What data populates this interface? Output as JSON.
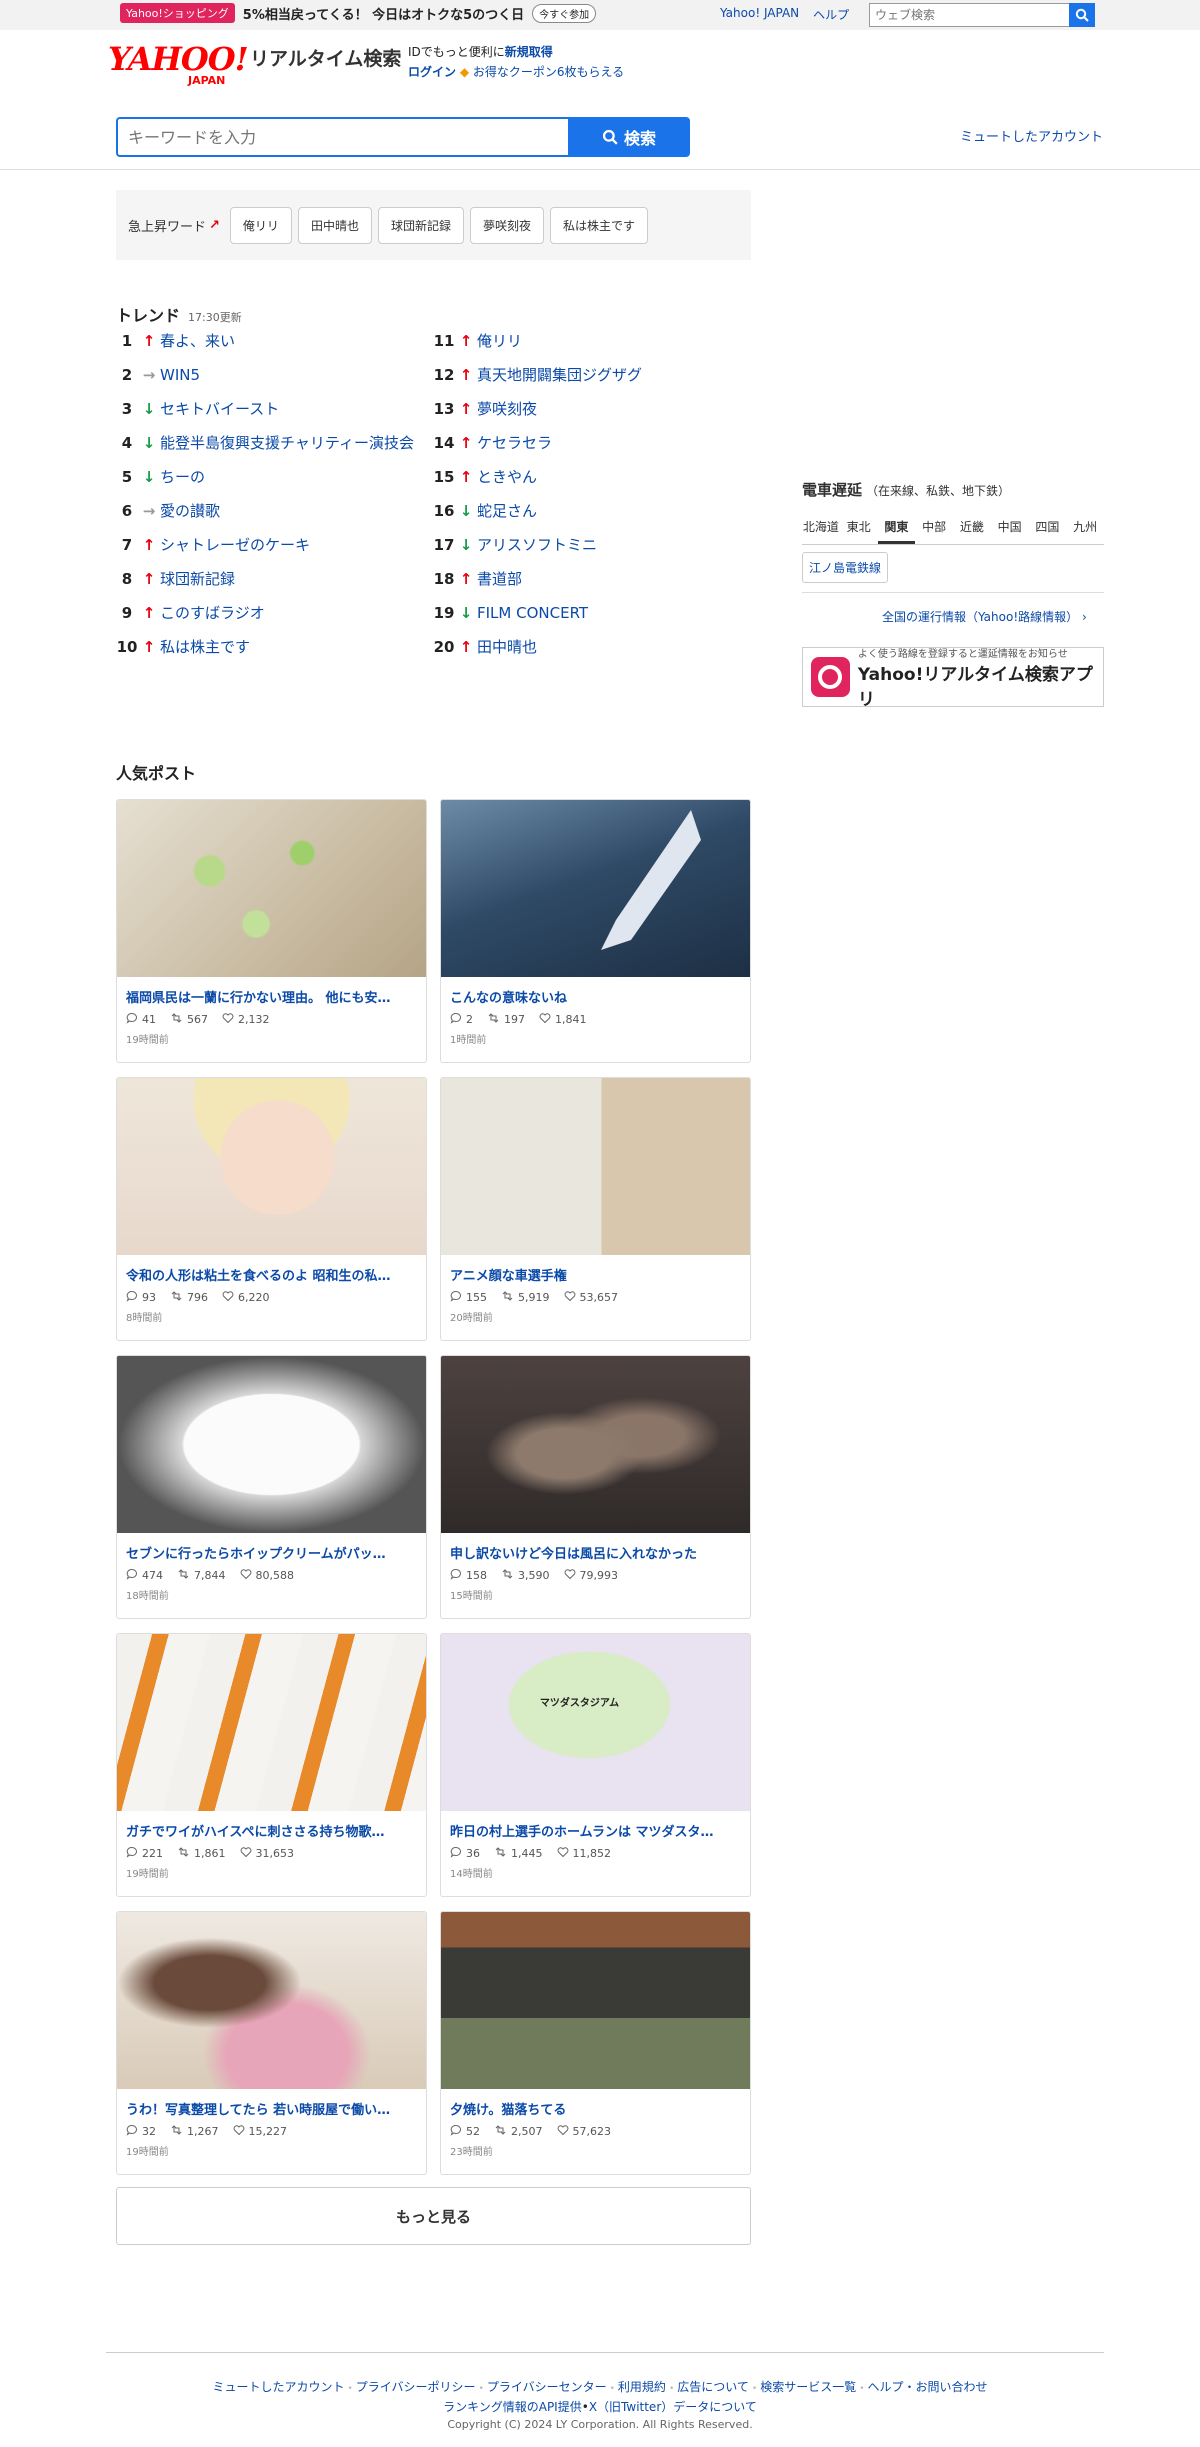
{
  "topbar": {
    "promo_tag": "Yahoo!ショッピング",
    "promo_text": "5%相当戻ってくる！ 今日はオトクな5のつく日",
    "promo_button": "今すぐ参加",
    "links": [
      "Yahoo! JAPAN",
      "ヘルプ"
    ],
    "web_search_placeholder": "ウェブ検索"
  },
  "header": {
    "logo": "YAHOO!",
    "logo_sub": "JAPAN",
    "service_name": "リアルタイム検索",
    "login_line1_prefix": "IDでもっと便利に",
    "login_line1_link": "新規取得",
    "login_link": "ログイン",
    "coupon": "お得なクーポン6枚もらえる",
    "search_placeholder": "キーワードを入力",
    "search_button": "検索",
    "muted_accounts": "ミュートしたアカウント"
  },
  "rising": {
    "label": "急上昇ワード",
    "words": [
      "俺リリ",
      "田中晴也",
      "球団新記録",
      "夢咲刻夜",
      "私は株主です"
    ]
  },
  "trend": {
    "title": "トレンド",
    "updated": "17:30更新",
    "items": [
      {
        "rank": "1",
        "dir": "up",
        "word": "春よ、来い"
      },
      {
        "rank": "2",
        "dir": "flat",
        "word": "WIN5"
      },
      {
        "rank": "3",
        "dir": "down",
        "word": "セキトバイースト"
      },
      {
        "rank": "4",
        "dir": "down",
        "word": "能登半島復興支援チャリティー演技会"
      },
      {
        "rank": "5",
        "dir": "down",
        "word": "ちーの"
      },
      {
        "rank": "6",
        "dir": "flat",
        "word": "愛の讃歌"
      },
      {
        "rank": "7",
        "dir": "up",
        "word": "シャトレーゼのケーキ"
      },
      {
        "rank": "8",
        "dir": "up",
        "word": "球団新記録"
      },
      {
        "rank": "9",
        "dir": "up",
        "word": "このすばラジオ"
      },
      {
        "rank": "10",
        "dir": "up",
        "word": "私は株主です"
      },
      {
        "rank": "11",
        "dir": "up",
        "word": "俺リリ"
      },
      {
        "rank": "12",
        "dir": "up",
        "word": "真天地開闢集団ジグザグ"
      },
      {
        "rank": "13",
        "dir": "up",
        "word": "夢咲刻夜"
      },
      {
        "rank": "14",
        "dir": "up",
        "word": "ケセラセラ"
      },
      {
        "rank": "15",
        "dir": "up",
        "word": "ときやん"
      },
      {
        "rank": "16",
        "dir": "down",
        "word": "蛇足さん"
      },
      {
        "rank": "17",
        "dir": "down",
        "word": "アリスソフトミニ"
      },
      {
        "rank": "18",
        "dir": "up",
        "word": "書道部"
      },
      {
        "rank": "19",
        "dir": "down",
        "word": "FILM CONCERT"
      },
      {
        "rank": "20",
        "dir": "up",
        "word": "田中晴也"
      }
    ]
  },
  "sidebar": {
    "train_title": "電車遅延",
    "train_sub": "（在来線、私鉄、地下鉄）",
    "regions": [
      "北海道",
      "東北",
      "関東",
      "中部",
      "近畿",
      "中国",
      "四国",
      "九州"
    ],
    "active_region": "関東",
    "delayed_line": "江ノ島電鉄線",
    "ops_link": "全国の運行情報（Yahoo!路線情報）",
    "app_small": "よく使う路線を登録すると運延情報をお知らせ",
    "app_big": "Yahoo!リアルタイム検索アプリ"
  },
  "posts": {
    "title": "人気ポスト",
    "items": [
      {
        "title": "福岡県民は一蘭に行かない理由。 他にも安…",
        "replies": "41",
        "reposts": "567",
        "likes": "2,132",
        "time": "19時間前",
        "img": "ramen"
      },
      {
        "title": "こんなの意味ないね",
        "replies": "2",
        "reposts": "197",
        "likes": "1,841",
        "time": "1時間前",
        "img": "anime-hand"
      },
      {
        "title": "令和の人形は粘土を食べるのよ 昭和生の私…",
        "replies": "93",
        "reposts": "796",
        "likes": "6,220",
        "time": "8時間前",
        "img": "doll"
      },
      {
        "title": "アニメ顔な車選手権",
        "replies": "155",
        "reposts": "5,919",
        "likes": "53,657",
        "time": "20時間前",
        "img": "car-sketch"
      },
      {
        "title": "セブンに行ったらホイップクリームがパッ…",
        "replies": "474",
        "reposts": "7,844",
        "likes": "80,588",
        "time": "18時間前",
        "img": "cream"
      },
      {
        "title": "申し訳ないけど今日は風呂に入れなかった",
        "replies": "158",
        "reposts": "3,590",
        "likes": "79,993",
        "time": "15時間前",
        "img": "hands-glass"
      },
      {
        "title": "ガチでワイがハイスペに刺ささる持ち物歌…",
        "replies": "221",
        "reposts": "1,861",
        "likes": "31,653",
        "time": "19時間前",
        "img": "tubes"
      },
      {
        "title": "昨日の村上選手のホームランは マツダスタ…",
        "replies": "36",
        "reposts": "1,445",
        "likes": "11,852",
        "time": "14時間前",
        "img": "map",
        "map_label": "マツダスタジアム"
      },
      {
        "title": "うわ！写真整理してたら 若い時服屋で働い…",
        "replies": "32",
        "reposts": "1,267",
        "likes": "15,227",
        "time": "19時間前",
        "img": "photo"
      },
      {
        "title": "夕焼け。猫落ちてる",
        "replies": "52",
        "reposts": "2,507",
        "likes": "57,623",
        "time": "23時間前",
        "img": "house"
      }
    ],
    "more_button": "もっと見る"
  },
  "footer": {
    "links": [
      "ミュートしたアカウント",
      "プライバシーポリシー",
      "プライバシーセンター",
      "利用規約",
      "広告について",
      "検索サービス一覧",
      "ヘルプ・お問い合わせ"
    ],
    "links2": [
      "ランキング情報のAPI提供",
      "X（旧Twitter）データについて"
    ],
    "copyright": "Copyright (C) 2024 LY Corporation. All Rights Reserved."
  },
  "colors": {
    "accent": "#1a73e8",
    "link": "#0b4aa8",
    "brand_red": "#ff0033",
    "up": "#e60012",
    "down": "#1a9a4a"
  }
}
